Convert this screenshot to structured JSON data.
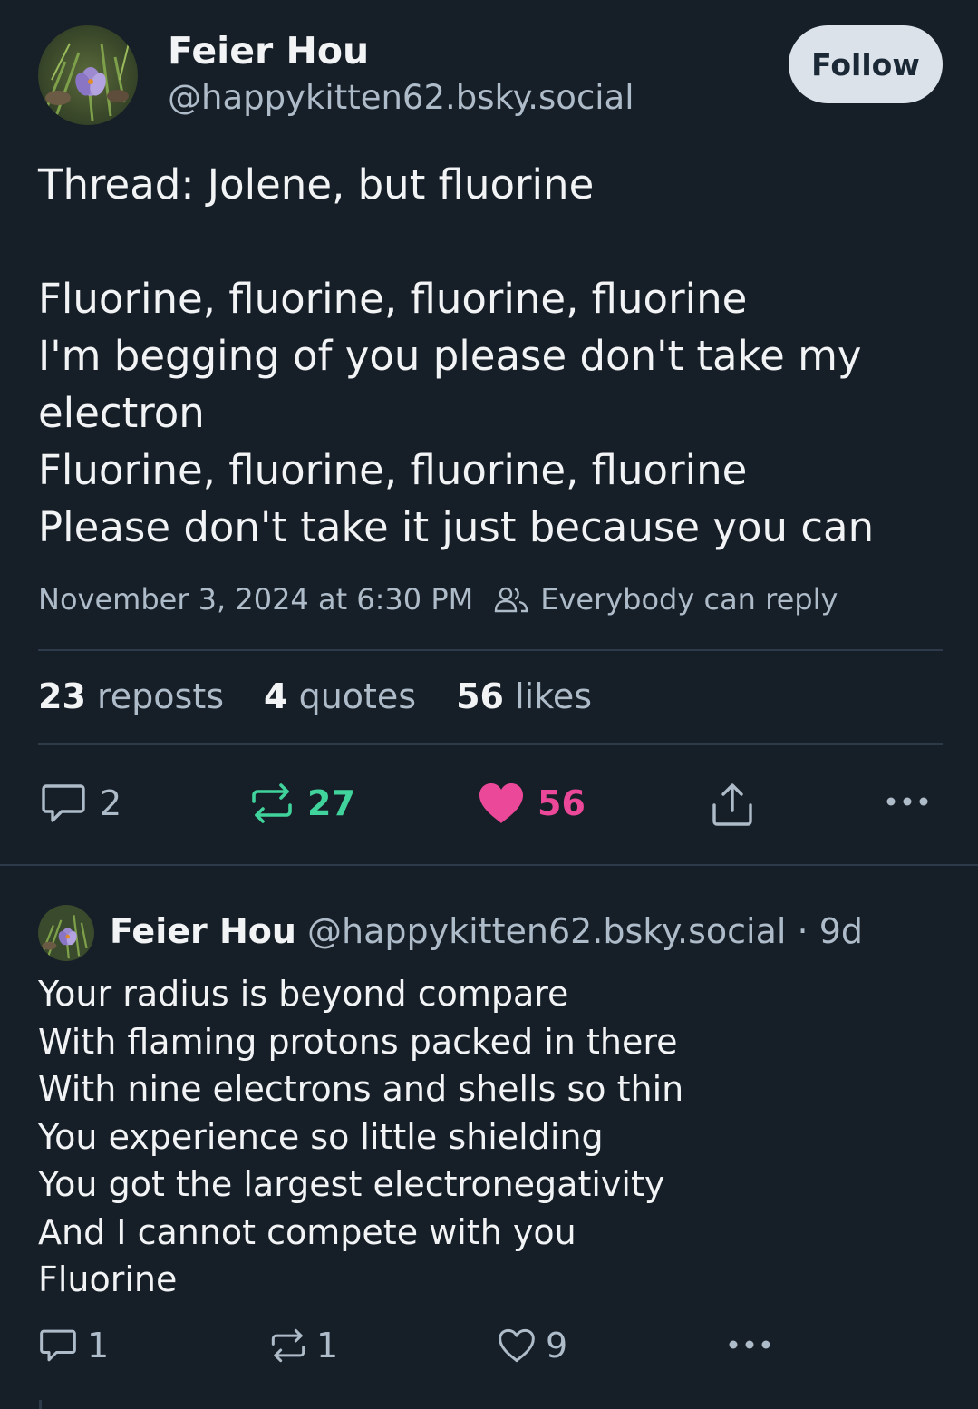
{
  "post": {
    "author_name": "Feier Hou",
    "author_handle": "@happykitten62.bsky.social",
    "follow_label": "Follow",
    "lines": [
      "Thread: Jolene, but fluorine",
      "",
      "Fluorine, fluorine, fluorine, fluorine",
      "I'm begging of you please don't take my",
      "electron",
      "Fluorine, fluorine, fluorine, fluorine",
      "Please don't take it just because you can"
    ],
    "timestamp": "November 3, 2024 at 6:30 PM",
    "reply_setting": "Everybody can reply",
    "stats": {
      "reposts_num": "23",
      "reposts_label": "reposts",
      "quotes_num": "4",
      "quotes_label": "quotes",
      "likes_num": "56",
      "likes_label": "likes"
    },
    "actions": {
      "reply_count": "2",
      "repost_count": "27",
      "like_count": "56"
    }
  },
  "reply": {
    "author_name": "Feier Hou",
    "author_handle": "@happykitten62.bsky.social",
    "age": "· 9d",
    "lines": [
      "Your radius is beyond compare",
      "With flaming protons packed in there",
      "With nine electrons and shells so thin",
      "You experience so little shielding",
      "You got the largest electronegativity",
      "And I cannot compete with you",
      "Fluorine"
    ],
    "actions": {
      "reply_count": "1",
      "repost_count": "1",
      "like_count": "9"
    }
  },
  "colors": {
    "background": "#161e27",
    "repost_active": "#40d39c",
    "like_active": "#ec4899",
    "muted": "#aebbc9"
  }
}
